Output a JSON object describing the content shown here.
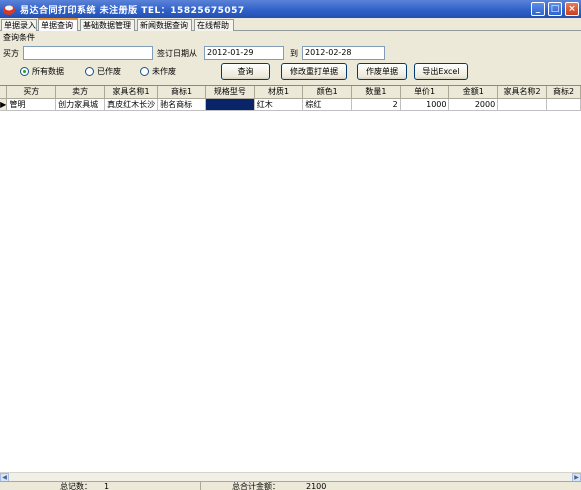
{
  "window": {
    "title": "易达合同打印系统 未注册版  TEL：15825675057",
    "min_label": "_",
    "max_label": "□",
    "close_label": "×"
  },
  "tabs": [
    "单据录入",
    "单据查询",
    "基础数据管理",
    "新闻数据查询",
    "在线帮助"
  ],
  "query": {
    "legend": "查询条件",
    "buyer_label": "买方",
    "buyer_value": "",
    "date_label": "签订日期从",
    "date_from": "2012-01-29",
    "date_to_label": "到",
    "date_to": "2012-02-28",
    "radios": [
      "所有数据",
      "已作废",
      "未作废"
    ],
    "buttons": [
      "查询",
      "修改重打单据",
      "作废单据",
      "导出Excel"
    ]
  },
  "grid": {
    "columns": [
      "买方",
      "卖方",
      "家具名称1",
      "商标1",
      "规格型号",
      "材质1",
      "颜色1",
      "数量1",
      "单价1",
      "金额1",
      "家具名称2",
      "商标2"
    ],
    "rows": [
      {
        "marker": "▶",
        "cells": [
          "管明",
          "创力家具城",
          "真皮红木长沙",
          "驰名商标",
          "",
          "红木",
          "棕红",
          "2",
          "1000",
          "2000",
          "",
          ""
        ]
      }
    ]
  },
  "status": {
    "count_label": "总记数：",
    "count_value": "1",
    "total_label": "总合计金额：",
    "total_value": "2100"
  }
}
